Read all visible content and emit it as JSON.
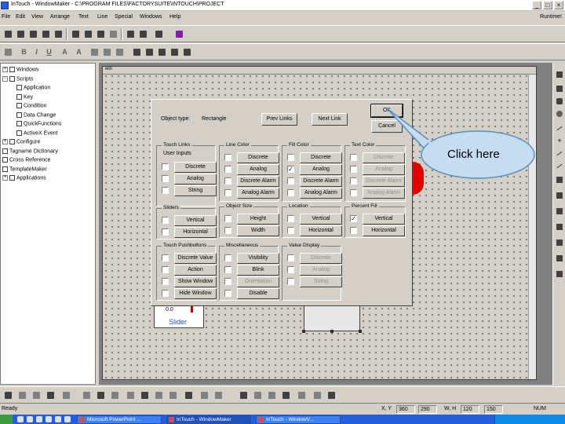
{
  "window": {
    "title": "InTouch - WindowMaker - C:\\PROGRAM FILES\\FACTORYSUITE\\INTOUCH\\PROJECT",
    "runtime": "Runtime!"
  },
  "menu": [
    "File",
    "Edit",
    "View",
    "Arrange",
    "Text",
    "Line",
    "Special",
    "Windows",
    "Help"
  ],
  "tree": [
    {
      "label": "Windows",
      "level": 0,
      "exp": "+"
    },
    {
      "label": "Scripts",
      "level": 0,
      "exp": "-"
    },
    {
      "label": "Application",
      "level": 1
    },
    {
      "label": "Key",
      "level": 1
    },
    {
      "label": "Condition",
      "level": 1
    },
    {
      "label": "Data Change",
      "level": 1
    },
    {
      "label": "QuickFunctions",
      "level": 1
    },
    {
      "label": "ActiveX Event",
      "level": 1
    },
    {
      "label": "Configure",
      "level": 0,
      "exp": "+"
    },
    {
      "label": "Tagname Dictionary",
      "level": 0
    },
    {
      "label": "Cross Reference",
      "level": 0
    },
    {
      "label": "TemplateMaker",
      "level": 0
    },
    {
      "label": "Applications",
      "level": 0,
      "exp": "+"
    }
  ],
  "canvas": {
    "title": "win"
  },
  "objects": {
    "slider_value": "0.0",
    "slider_label": "Slider"
  },
  "dialog": {
    "object_type_label": "Object type:",
    "object_type_value": "Rectangle",
    "prev_links": "Prev Links",
    "next_link": "Next Link",
    "ok": "OK",
    "cancel": "Cancel",
    "groups": {
      "touch_links": {
        "title": "Touch Links",
        "sub": "User Inputs",
        "items": [
          "Discrete",
          "Analog",
          "String"
        ]
      },
      "sliders": {
        "title": "Sliders",
        "items": [
          "Vertical",
          "Horizontal"
        ]
      },
      "pushbuttons": {
        "title": "Touch Pushbuttons",
        "items": [
          "Discrete Value",
          "Action",
          "Show Window",
          "Hide Window"
        ]
      },
      "line_color": {
        "title": "Line Color",
        "items": [
          "Discrete",
          "Analog",
          "Discrete Alarm",
          "Analog Alarm"
        ]
      },
      "fill_color": {
        "title": "Fill Color",
        "items": [
          "Discrete",
          "Analog",
          "Discrete Alarm",
          "Analog Alarm"
        ]
      },
      "text_color": {
        "title": "Text Color",
        "items": [
          "Discrete",
          "Analog",
          "Discrete Alarm",
          "Analog Alarm"
        ]
      },
      "object_size": {
        "title": "Object Size",
        "items": [
          "Height",
          "Width"
        ]
      },
      "location": {
        "title": "Location",
        "items": [
          "Vertical",
          "Horizontal"
        ]
      },
      "percent_fill": {
        "title": "Percent Fill",
        "items": [
          "Vertical",
          "Horizontal"
        ]
      },
      "misc": {
        "title": "Miscellaneous",
        "items": [
          "Visibility",
          "Blink",
          "Orientation",
          "Disable"
        ]
      },
      "value_display": {
        "title": "Value Display",
        "items": [
          "Discrete",
          "Analog",
          "String"
        ]
      }
    }
  },
  "callout": "Click here",
  "status": {
    "ready": "Ready",
    "xy_label": "X, Y",
    "x": "360",
    "y": "290",
    "wh_label": "W, H",
    "w": "120",
    "h": "150",
    "num": "NUM"
  },
  "taskbar": [
    "Microsoft PowerPoint ...",
    "InTouch - WindowMaker",
    "InTouch - WindowV..."
  ],
  "colors": {
    "fill_shape": "#e00000",
    "callout_fill": "#c6dcf0",
    "callout_stroke": "#5a8fbf",
    "taskbar": "#245edb"
  }
}
